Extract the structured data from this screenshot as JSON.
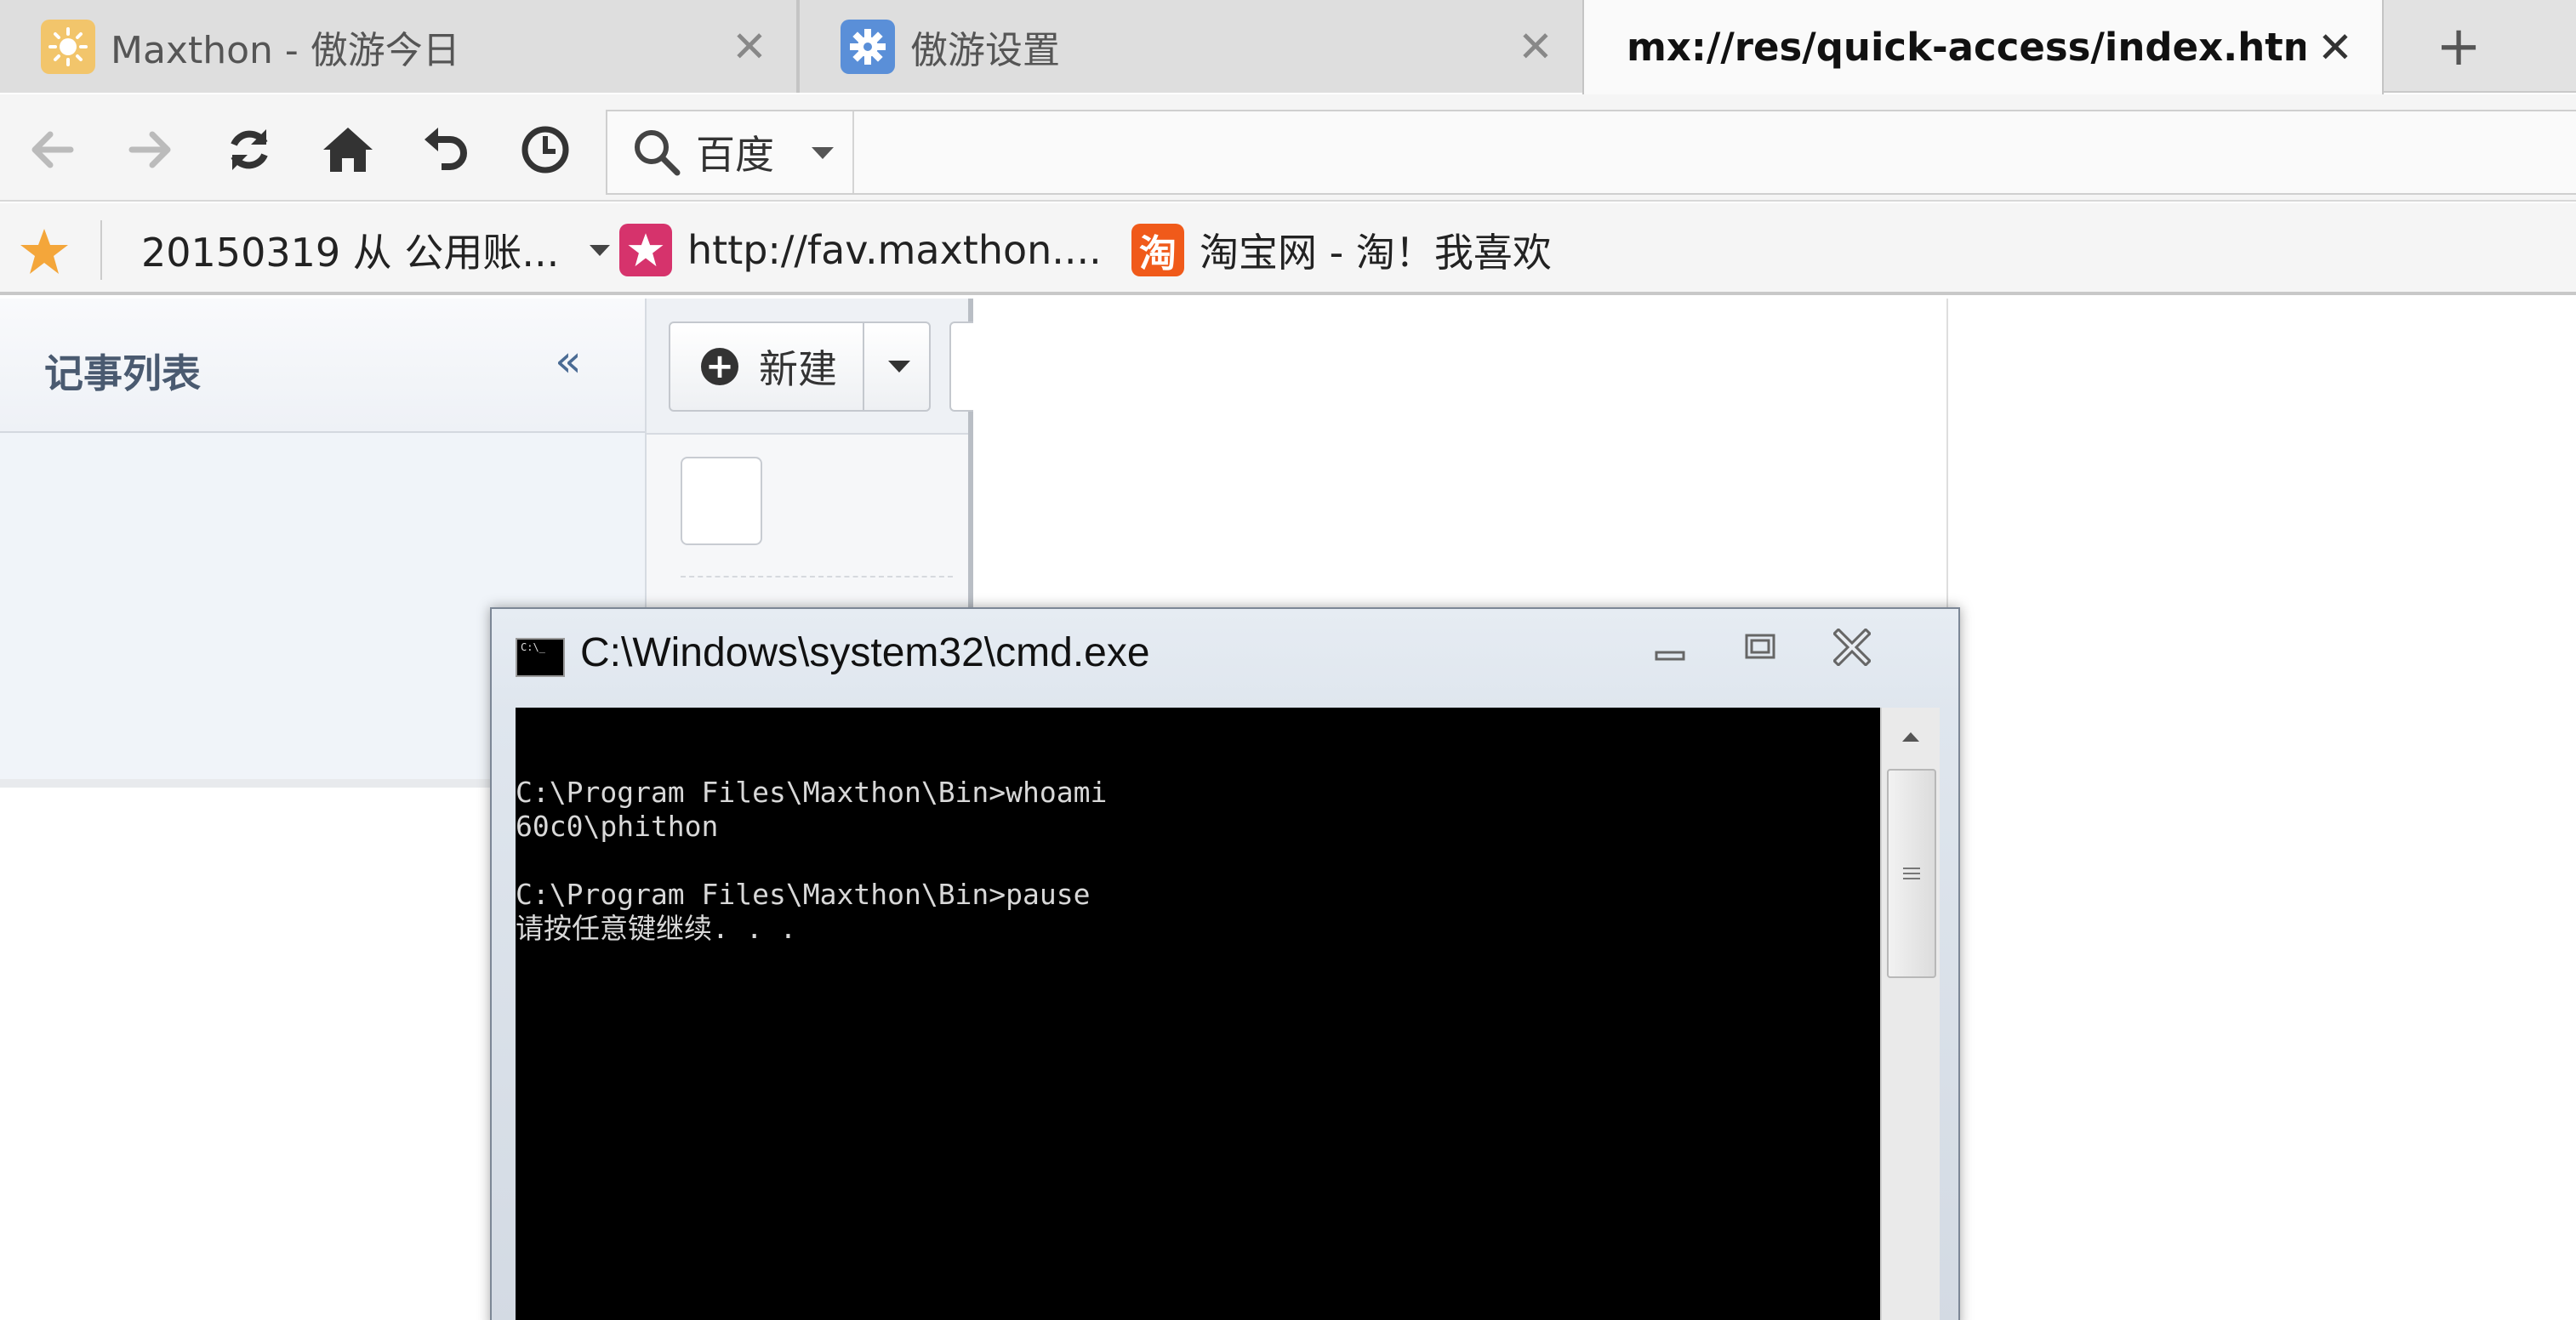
{
  "tabs": [
    {
      "title": "Maxthon - 傲游今日",
      "icon": "sun-icon",
      "close": "✕"
    },
    {
      "title": "傲游设置",
      "icon": "gear-icon",
      "close": "✕"
    },
    {
      "title": "mx://res/quick-access/index.htm",
      "icon": "",
      "close": "✕",
      "active": true
    }
  ],
  "new_tab": "+",
  "search": {
    "engine": "百度",
    "value": ""
  },
  "bookmarks": {
    "items": [
      {
        "label": "20150319 从 公用账...",
        "icon": "folder-icon"
      },
      {
        "label": "http://fav.maxthon....",
        "icon": "star-icon"
      },
      {
        "label": "淘宝网 - 淘！我喜欢",
        "icon": "taobao-icon",
        "icon_text": "淘"
      }
    ]
  },
  "notes": {
    "title": "记事列表",
    "collapse": "«"
  },
  "toolbar": {
    "new_label": "新建"
  },
  "cmd": {
    "title": "C:\\Windows\\system32\\cmd.exe",
    "icon_text": "C:\\_",
    "lines": [
      "",
      "C:\\Program Files\\Maxthon\\Bin>whoami",
      "60c0\\phithon",
      "",
      "C:\\Program Files\\Maxthon\\Bin>pause",
      "请按任意键继续. . ."
    ]
  },
  "colors": {
    "accent": "#f4a63a",
    "taobao": "#f05a1a",
    "console_bg": "#000000",
    "console_fg": "#d8d8d8"
  }
}
